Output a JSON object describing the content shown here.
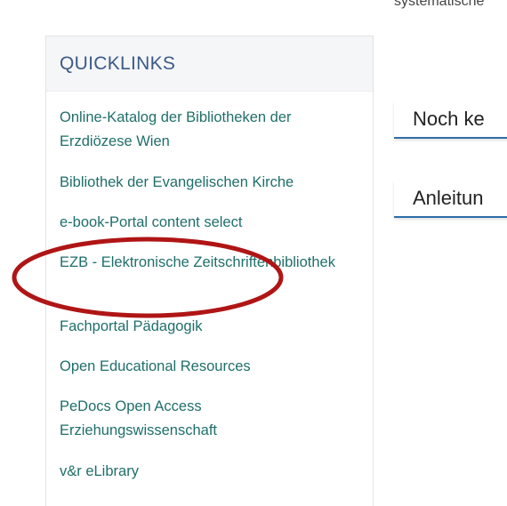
{
  "main": {
    "top_text": "systematische",
    "tabs": [
      {
        "label": "Noch ke"
      },
      {
        "label": "Anleitun"
      }
    ]
  },
  "quicklinks": {
    "title": "QUICKLINKS",
    "items": [
      {
        "label": "Online-Katalog der Bibliotheken der Erzdiözese Wien"
      },
      {
        "label": "Bibliothek der Evangelischen Kirche"
      },
      {
        "label": "e-book-Portal content select"
      },
      {
        "label": "EZB - Elektronische Zeitschriftenbibliothek"
      },
      {
        "label": "Fachportal Pädagogik"
      },
      {
        "label": "Open Educational Resources"
      },
      {
        "label": "PeDocs Open Access Erziehungswissenschaft"
      },
      {
        "label": "v&r eLibrary"
      }
    ]
  },
  "colors": {
    "link": "#1f6f6a",
    "title": "#3c5a88",
    "highlight": "#b01515"
  }
}
